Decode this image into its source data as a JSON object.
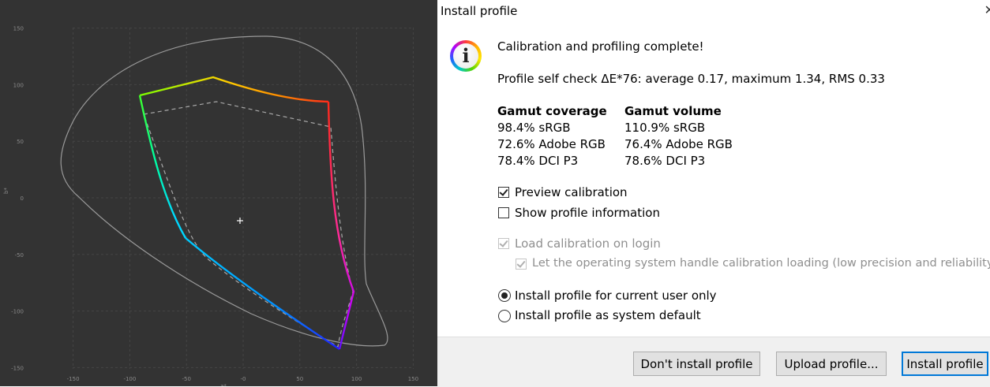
{
  "plot": {
    "x_ticks": [
      "-150",
      "-100",
      "-50",
      "-0",
      "50",
      "100",
      "150"
    ],
    "y_ticks": [
      "150",
      "100",
      "50",
      "0",
      "-50",
      "-100",
      "-150"
    ],
    "x_label": "a*",
    "y_label": "b*"
  },
  "dialog": {
    "title": "Install profile",
    "close_glyph": "✕",
    "heading": "Calibration and profiling complete!",
    "self_check": "Profile self check ΔE*76: average 0.17, maximum 1.34, RMS 0.33",
    "gamut_coverage": {
      "header": "Gamut coverage",
      "rows": [
        "98.4% sRGB",
        "72.6% Adobe RGB",
        "78.4% DCI P3"
      ]
    },
    "gamut_volume": {
      "header": "Gamut volume",
      "rows": [
        "110.9% sRGB",
        "76.4% Adobe RGB",
        "78.6% DCI P3"
      ]
    },
    "options": {
      "preview_calibration": "Preview calibration",
      "show_profile_info": "Show profile information",
      "load_calibration": "Load calibration on login",
      "os_handle": "Let the operating system handle calibration loading (low precision and reliability)"
    },
    "install_scope": {
      "current_user": "Install profile for current user only",
      "system_default": "Install profile as system default"
    },
    "buttons": {
      "dont_install": "Don't install profile",
      "upload": "Upload profile...",
      "install": "Install profile"
    },
    "icon": "info-icon"
  }
}
